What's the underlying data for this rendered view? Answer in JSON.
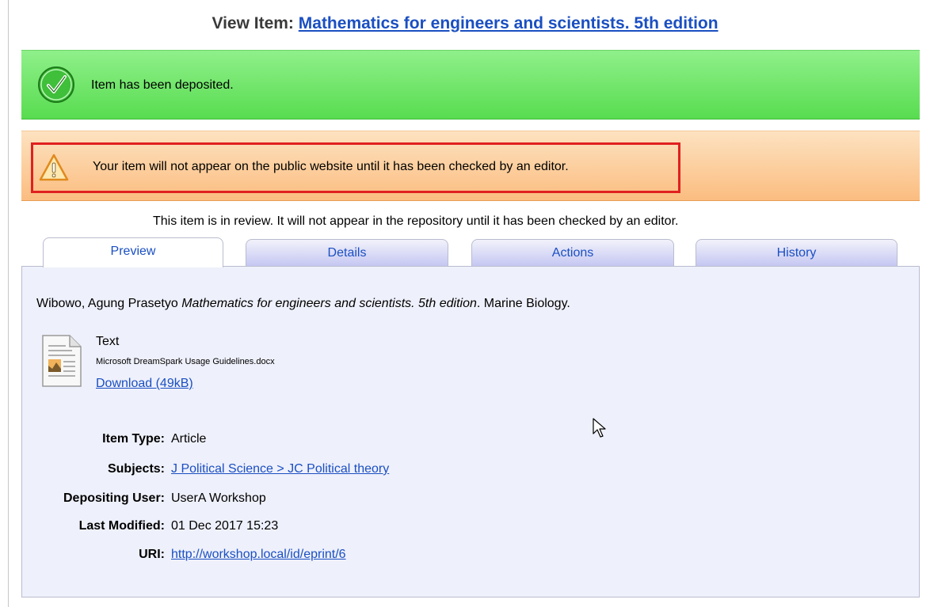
{
  "page": {
    "title_prefix": "View Item:",
    "title_link": "Mathematics for engineers and scientists. 5th edition"
  },
  "messages": {
    "success": "Item has been deposited.",
    "warning": "Your item will not appear on the public website until it has been checked by an editor."
  },
  "review_notice": "This item is in review. It will not appear in the repository until it has been checked by an editor.",
  "tabs": [
    {
      "label": "Preview",
      "active": true
    },
    {
      "label": "Details",
      "active": false
    },
    {
      "label": "Actions",
      "active": false
    },
    {
      "label": "History",
      "active": false
    }
  ],
  "citation": {
    "author": "Wibowo, Agung Prasetyo",
    "title": "Mathematics for engineers and scientists. 5th edition",
    "journal": "Marine Biology."
  },
  "document": {
    "type": "Text",
    "filename": "Microsoft DreamSpark Usage Guidelines.docx",
    "download": "Download (49kB)"
  },
  "metadata": [
    {
      "label": "Item Type:",
      "value": "Article",
      "link": false
    },
    {
      "label": "Subjects:",
      "value": "J Political Science > JC Political theory",
      "link": true
    },
    {
      "label": "Depositing User:",
      "value": "UserA Workshop",
      "link": false
    },
    {
      "label": "Last Modified:",
      "value": "01 Dec 2017 15:23",
      "link": false
    },
    {
      "label": "URI:",
      "value": "http://workshop.local/id/eprint/6",
      "link": true
    }
  ],
  "colors": {
    "link": "#1a4fc2",
    "success_bg": "#58dc50",
    "warning_bg": "#fbbd80",
    "highlight_border": "#e02020",
    "panel_bg": "#eef0fb"
  },
  "icons": {
    "success": "check-circle-icon",
    "warning": "warning-triangle-icon",
    "document": "document-image-icon",
    "cursor": "mouse-pointer-icon"
  }
}
